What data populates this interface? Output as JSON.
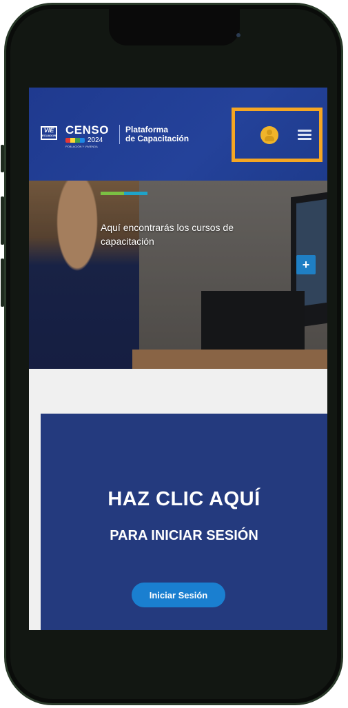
{
  "header": {
    "vie_logo": "VIE",
    "vie_logo_sub": "ECUADOR",
    "censo_word": "CENSO",
    "censo_year": "2024",
    "censo_tagline": "POBLACIÓN Y VIVIENDA",
    "platform_line1": "Plataforma",
    "platform_line2": "de Capacitación",
    "icons": [
      "user-icon",
      "menu-icon"
    ],
    "highlight_color": "#f5a623"
  },
  "hero": {
    "text": "Aquí encontrarás los cursos de capacitación",
    "plus_label": "+"
  },
  "login_card": {
    "title": "HAZ CLIC AQUÍ",
    "subtitle": "PARA INICIAR SESIÓN",
    "button_label": "Iniciar Sesión"
  },
  "colors": {
    "header_bg": "#1f3a8f",
    "card_bg": "#243a7e",
    "button_bg": "#1a7fd0",
    "accent_orange": "#f5a623"
  }
}
